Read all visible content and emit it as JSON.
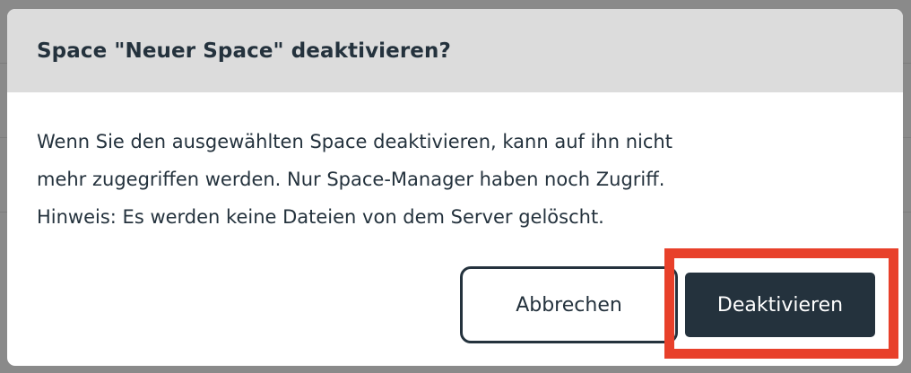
{
  "dialog": {
    "title": "Space \"Neuer Space\" deaktivieren?",
    "message_line_1": "Wenn Sie den ausgewählten Space deaktivieren, kann auf ihn nicht",
    "message_line_2": "mehr zugegriffen werden. Nur Space-Manager haben noch Zugriff.",
    "message_line_3": "Hinweis: Es werden keine Dateien von dem Server gelöscht.",
    "cancel_label": "Abbrechen",
    "confirm_label": "Deaktivieren"
  },
  "colors": {
    "header_background": "#dcdcdc",
    "text": "#24323d",
    "primary_button": "#24323d",
    "highlight_box": "#e8402a",
    "overlay": "#8a8a8a"
  }
}
